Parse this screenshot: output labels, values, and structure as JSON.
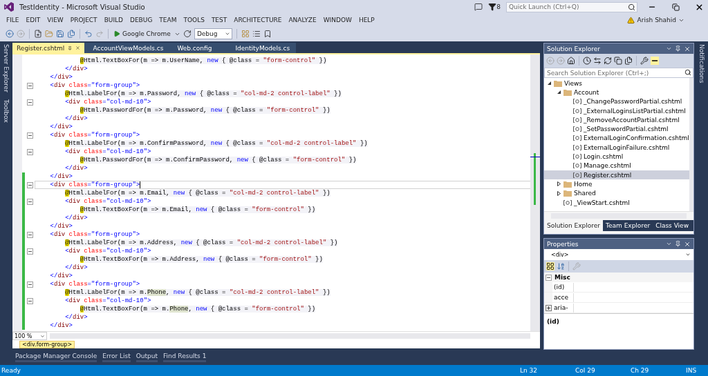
{
  "window": {
    "title": "TestIdentity - Microsoft Visual Studio",
    "notification_count": "8",
    "quick_launch": {
      "placeholder": "Quick Launch (Ctrl+Q)"
    }
  },
  "menu": [
    "FILE",
    "EDIT",
    "VIEW",
    "PROJECT",
    "BUILD",
    "DEBUG",
    "TEAM",
    "TOOLS",
    "TEST",
    "ARCHITECTURE",
    "ANALYZE",
    "WINDOW",
    "HELP"
  ],
  "user": {
    "name": "Arish Shahid"
  },
  "toolbar": {
    "run_target": "Google Chrome",
    "configuration": "Debug"
  },
  "side_tabs": [
    "Server Explorer",
    "Toolbox"
  ],
  "editor": {
    "tabs": [
      {
        "label": "Register.cshtml",
        "selected": true
      },
      {
        "label": "AccountViewModels.cs",
        "selected": false
      },
      {
        "label": "Web.config",
        "selected": false
      },
      {
        "label": "IdentityModels.cs",
        "selected": false
      }
    ],
    "lines": [
      {
        "fold": false,
        "changed": false,
        "current": false,
        "tokens": [
          {
            "kind": "at",
            "text": "@"
          },
          {
            "kind": "code",
            "text": "Html.TextBoxFor(m => m.UserName, "
          },
          {
            "kind": "kw",
            "text": "new"
          },
          {
            "kind": "code",
            "text": " { @class = "
          },
          {
            "kind": "str",
            "text": "\"form-control\""
          },
          {
            "kind": "code",
            "text": " })"
          }
        ]
      },
      {
        "fold": false,
        "changed": false,
        "current": false,
        "tokens": [
          {
            "kind": "close",
            "text": "</"
          },
          {
            "kind": "element",
            "text": "div"
          },
          {
            "kind": "punct",
            "text": ">"
          }
        ]
      },
      {
        "fold": false,
        "changed": false,
        "current": false,
        "tokens": [
          {
            "kind": "close",
            "text": "</"
          },
          {
            "kind": "element",
            "text": "div"
          },
          {
            "kind": "punct",
            "text": ">"
          }
        ]
      },
      {
        "fold": true,
        "changed": false,
        "current": false,
        "tokens": [
          {
            "kind": "open",
            "text": "<"
          },
          {
            "kind": "element",
            "text": "div"
          },
          {
            "kind": "attr",
            "text": " class"
          },
          {
            "kind": "punct",
            "text": "="
          },
          {
            "kind": "val",
            "text": "\"form-group\""
          },
          {
            "kind": "punct",
            "text": ">"
          }
        ]
      },
      {
        "fold": false,
        "changed": false,
        "current": false,
        "tokens": [
          {
            "kind": "at",
            "text": "@"
          },
          {
            "kind": "code",
            "text": "Html.LabelFor(m => m.Password, "
          },
          {
            "kind": "kw",
            "text": "new"
          },
          {
            "kind": "code",
            "text": " { @class = "
          },
          {
            "kind": "str",
            "text": "\"col-md-2 control-label\""
          },
          {
            "kind": "code",
            "text": " })"
          }
        ]
      },
      {
        "fold": true,
        "changed": false,
        "current": false,
        "tokens": [
          {
            "kind": "open",
            "text": "<"
          },
          {
            "kind": "element",
            "text": "div"
          },
          {
            "kind": "attr",
            "text": " class"
          },
          {
            "kind": "punct",
            "text": "="
          },
          {
            "kind": "val",
            "text": "\"col-md-10\""
          },
          {
            "kind": "punct",
            "text": ">"
          }
        ]
      },
      {
        "fold": false,
        "changed": false,
        "current": false,
        "tokens": [
          {
            "kind": "at",
            "text": "@"
          },
          {
            "kind": "code",
            "text": "Html.PasswordFor(m => m.Password, "
          },
          {
            "kind": "kw",
            "text": "new"
          },
          {
            "kind": "code",
            "text": " { @class = "
          },
          {
            "kind": "str",
            "text": "\"form-control\""
          },
          {
            "kind": "code",
            "text": " })"
          }
        ]
      },
      {
        "fold": false,
        "changed": false,
        "current": false,
        "tokens": [
          {
            "kind": "close",
            "text": "</"
          },
          {
            "kind": "element",
            "text": "div"
          },
          {
            "kind": "punct",
            "text": ">"
          }
        ]
      },
      {
        "fold": false,
        "changed": false,
        "current": false,
        "tokens": [
          {
            "kind": "close",
            "text": "</"
          },
          {
            "kind": "element",
            "text": "div"
          },
          {
            "kind": "punct",
            "text": ">"
          }
        ]
      },
      {
        "fold": true,
        "changed": false,
        "current": false,
        "tokens": [
          {
            "kind": "open",
            "text": "<"
          },
          {
            "kind": "element",
            "text": "div"
          },
          {
            "kind": "attr",
            "text": " class"
          },
          {
            "kind": "punct",
            "text": "="
          },
          {
            "kind": "val",
            "text": "\"form-group\""
          },
          {
            "kind": "punct",
            "text": ">"
          }
        ]
      },
      {
        "fold": false,
        "changed": false,
        "current": false,
        "tokens": [
          {
            "kind": "at",
            "text": "@"
          },
          {
            "kind": "code",
            "text": "Html.LabelFor(m => m.ConfirmPassword, "
          },
          {
            "kind": "kw",
            "text": "new"
          },
          {
            "kind": "code",
            "text": " { @class = "
          },
          {
            "kind": "str",
            "text": "\"col-md-2 control-label\""
          },
          {
            "kind": "code",
            "text": " })"
          }
        ]
      },
      {
        "fold": true,
        "changed": false,
        "current": false,
        "tokens": [
          {
            "kind": "open",
            "text": "<"
          },
          {
            "kind": "element",
            "text": "div"
          },
          {
            "kind": "attr",
            "text": " class"
          },
          {
            "kind": "punct",
            "text": "="
          },
          {
            "kind": "val",
            "text": "\"col-md-10\""
          },
          {
            "kind": "punct",
            "text": ">"
          }
        ]
      },
      {
        "fold": false,
        "changed": false,
        "current": false,
        "tokens": [
          {
            "kind": "at",
            "text": "@"
          },
          {
            "kind": "code",
            "text": "Html.PasswordFor(m => m.ConfirmPassword, "
          },
          {
            "kind": "kw",
            "text": "new"
          },
          {
            "kind": "code",
            "text": " { @class = "
          },
          {
            "kind": "str",
            "text": "\"form-control\""
          },
          {
            "kind": "code",
            "text": " })"
          }
        ]
      },
      {
        "fold": false,
        "changed": false,
        "current": false,
        "tokens": [
          {
            "kind": "close",
            "text": "</"
          },
          {
            "kind": "element",
            "text": "div"
          },
          {
            "kind": "punct",
            "text": ">"
          }
        ]
      },
      {
        "fold": false,
        "changed": true,
        "current": false,
        "tokens": [
          {
            "kind": "close",
            "text": "</"
          },
          {
            "kind": "element",
            "text": "div"
          },
          {
            "kind": "punct",
            "text": ">"
          }
        ]
      },
      {
        "fold": true,
        "changed": true,
        "current": true,
        "tokens": [
          {
            "kind": "open",
            "text": "<"
          },
          {
            "kind": "element",
            "text": "div"
          },
          {
            "kind": "attr",
            "text": " class"
          },
          {
            "kind": "punct",
            "text": "="
          },
          {
            "kind": "val",
            "text": "\"form-group\""
          },
          {
            "kind": "punct",
            "text": ">"
          }
        ]
      },
      {
        "fold": false,
        "changed": true,
        "current": false,
        "tokens": [
          {
            "kind": "at",
            "text": "@"
          },
          {
            "kind": "code",
            "text": "Html.LabelFor(m => m.Email, "
          },
          {
            "kind": "kw",
            "text": "new"
          },
          {
            "kind": "code",
            "text": " { @class = "
          },
          {
            "kind": "str",
            "text": "\"col-md-2 control-label\""
          },
          {
            "kind": "code",
            "text": " })"
          }
        ]
      },
      {
        "fold": true,
        "changed": true,
        "current": false,
        "tokens": [
          {
            "kind": "open",
            "text": "<"
          },
          {
            "kind": "element",
            "text": "div"
          },
          {
            "kind": "attr",
            "text": " class"
          },
          {
            "kind": "punct",
            "text": "="
          },
          {
            "kind": "val",
            "text": "\"col-md-10\""
          },
          {
            "kind": "punct",
            "text": ">"
          }
        ]
      },
      {
        "fold": false,
        "changed": true,
        "current": false,
        "tokens": [
          {
            "kind": "at",
            "text": "@"
          },
          {
            "kind": "code",
            "text": "Html.TextBoxFor(m => m.Email, "
          },
          {
            "kind": "kw",
            "text": "new"
          },
          {
            "kind": "code",
            "text": " { @class = "
          },
          {
            "kind": "str",
            "text": "\"form-control\""
          },
          {
            "kind": "code",
            "text": " })"
          }
        ]
      },
      {
        "fold": false,
        "changed": true,
        "current": false,
        "tokens": [
          {
            "kind": "close",
            "text": "</"
          },
          {
            "kind": "element",
            "text": "div"
          },
          {
            "kind": "punct",
            "text": ">"
          }
        ]
      },
      {
        "fold": false,
        "changed": true,
        "current": false,
        "tokens": [
          {
            "kind": "close",
            "text": "</"
          },
          {
            "kind": "element",
            "text": "div"
          },
          {
            "kind": "punct",
            "text": ">"
          }
        ]
      },
      {
        "fold": true,
        "changed": true,
        "current": false,
        "tokens": [
          {
            "kind": "open",
            "text": "<"
          },
          {
            "kind": "element",
            "text": "div"
          },
          {
            "kind": "attr",
            "text": " class"
          },
          {
            "kind": "punct",
            "text": "="
          },
          {
            "kind": "val",
            "text": "\"form-group\""
          },
          {
            "kind": "punct",
            "text": ">"
          }
        ]
      },
      {
        "fold": false,
        "changed": true,
        "current": false,
        "tokens": [
          {
            "kind": "at",
            "text": "@"
          },
          {
            "kind": "code",
            "text": "Html.LabelFor(m => m.Address, "
          },
          {
            "kind": "kw",
            "text": "new"
          },
          {
            "kind": "code",
            "text": " { @class = "
          },
          {
            "kind": "str",
            "text": "\"col-md-2 control-label\""
          },
          {
            "kind": "code",
            "text": " })"
          }
        ]
      },
      {
        "fold": true,
        "changed": true,
        "current": false,
        "tokens": [
          {
            "kind": "open",
            "text": "<"
          },
          {
            "kind": "element",
            "text": "div"
          },
          {
            "kind": "attr",
            "text": " class"
          },
          {
            "kind": "punct",
            "text": "="
          },
          {
            "kind": "val",
            "text": "\"col-md-10\""
          },
          {
            "kind": "punct",
            "text": ">"
          }
        ]
      },
      {
        "fold": false,
        "changed": true,
        "current": false,
        "tokens": [
          {
            "kind": "at",
            "text": "@"
          },
          {
            "kind": "code",
            "text": "Html.TextBoxFor(m => m.Address, "
          },
          {
            "kind": "kw",
            "text": "new"
          },
          {
            "kind": "code",
            "text": " { @class = "
          },
          {
            "kind": "str",
            "text": "\"form-control\""
          },
          {
            "kind": "code",
            "text": " })"
          }
        ]
      },
      {
        "fold": false,
        "changed": true,
        "current": false,
        "tokens": [
          {
            "kind": "close",
            "text": "</"
          },
          {
            "kind": "element",
            "text": "div"
          },
          {
            "kind": "punct",
            "text": ">"
          }
        ]
      },
      {
        "fold": false,
        "changed": true,
        "current": false,
        "tokens": [
          {
            "kind": "close",
            "text": "</"
          },
          {
            "kind": "element",
            "text": "div"
          },
          {
            "kind": "punct",
            "text": ">"
          }
        ]
      },
      {
        "fold": true,
        "changed": true,
        "current": false,
        "tokens": [
          {
            "kind": "open",
            "text": "<"
          },
          {
            "kind": "element",
            "text": "div"
          },
          {
            "kind": "attr",
            "text": " class"
          },
          {
            "kind": "punct",
            "text": "="
          },
          {
            "kind": "val",
            "text": "\"form-group\""
          },
          {
            "kind": "punct",
            "text": ">"
          }
        ]
      },
      {
        "fold": false,
        "changed": true,
        "current": false,
        "tokens": [
          {
            "kind": "at",
            "text": "@"
          },
          {
            "kind": "code",
            "text": "Html.LabelFor(m => m."
          },
          {
            "kind": "ref",
            "text": "Phone"
          },
          {
            "kind": "code",
            "text": ", "
          },
          {
            "kind": "kw",
            "text": "new"
          },
          {
            "kind": "code",
            "text": " { @class = "
          },
          {
            "kind": "str",
            "text": "\"col-md-2 control-label\""
          },
          {
            "kind": "code",
            "text": " })"
          }
        ]
      },
      {
        "fold": true,
        "changed": true,
        "current": false,
        "tokens": [
          {
            "kind": "open",
            "text": "<"
          },
          {
            "kind": "element",
            "text": "div"
          },
          {
            "kind": "attr",
            "text": " class"
          },
          {
            "kind": "punct",
            "text": "="
          },
          {
            "kind": "val",
            "text": "\"col-md-10\""
          },
          {
            "kind": "punct",
            "text": ">"
          }
        ]
      },
      {
        "fold": false,
        "changed": true,
        "current": false,
        "tokens": [
          {
            "kind": "at",
            "text": "@"
          },
          {
            "kind": "code",
            "text": "Html.TextBoxFor(m => m."
          },
          {
            "kind": "ref",
            "text": "Phone"
          },
          {
            "kind": "code",
            "text": ", "
          },
          {
            "kind": "kw",
            "text": "new"
          },
          {
            "kind": "code",
            "text": " { @class = "
          },
          {
            "kind": "str",
            "text": "\"form-control\""
          },
          {
            "kind": "code",
            "text": " })"
          }
        ]
      },
      {
        "fold": false,
        "changed": true,
        "current": false,
        "tokens": [
          {
            "kind": "close",
            "text": "</"
          },
          {
            "kind": "element",
            "text": "div"
          },
          {
            "kind": "punct",
            "text": ">"
          }
        ]
      },
      {
        "fold": false,
        "changed": true,
        "current": false,
        "tokens": [
          {
            "kind": "close",
            "text": "</"
          },
          {
            "kind": "element",
            "text": "div"
          },
          {
            "kind": "punct",
            "text": ">"
          }
        ]
      }
    ],
    "zoom": "100 %",
    "breadcrumb": "<div.form-group>"
  },
  "solution_explorer": {
    "title": "Solution Explorer",
    "search": {
      "placeholder": "Search Solution Explorer (Ctrl+;)"
    },
    "tree": [
      {
        "label": "Views",
        "kind": "folder",
        "expanded": true,
        "selected": false,
        "children": [
          {
            "label": "Account",
            "kind": "folder",
            "expanded": true,
            "selected": false,
            "children": [
              {
                "label": "_ChangePasswordPartial.cshtml",
                "kind": "file",
                "selected": false
              },
              {
                "label": "_ExternalLoginsListPartial.cshtml",
                "kind": "file",
                "selected": false
              },
              {
                "label": "_RemoveAccountPartial.cshtml",
                "kind": "file",
                "selected": false
              },
              {
                "label": "_SetPasswordPartial.cshtml",
                "kind": "file",
                "selected": false
              },
              {
                "label": "ExternalLoginConfirmation.cshtml",
                "kind": "file",
                "selected": false
              },
              {
                "label": "ExternalLoginFailure.cshtml",
                "kind": "file",
                "selected": false
              },
              {
                "label": "Login.cshtml",
                "kind": "file",
                "selected": false
              },
              {
                "label": "Manage.cshtml",
                "kind": "file",
                "selected": false
              },
              {
                "label": "Register.cshtml",
                "kind": "file",
                "selected": true
              }
            ]
          },
          {
            "label": "Home",
            "kind": "folder",
            "expanded": false,
            "selected": false
          },
          {
            "label": "Shared",
            "kind": "folder",
            "expanded": false,
            "selected": false
          },
          {
            "label": "_ViewStart.cshtml",
            "kind": "file",
            "selected": false
          }
        ]
      }
    ],
    "tabs": [
      {
        "label": "Solution Explorer",
        "selected": true
      },
      {
        "label": "Team Explorer",
        "selected": false
      },
      {
        "label": "Class View",
        "selected": false
      }
    ]
  },
  "properties": {
    "title": "Properties",
    "object": "<div>",
    "category": "Misc",
    "rows": [
      {
        "name": "(id)",
        "expandable": false
      },
      {
        "name": "acce",
        "expandable": false
      },
      {
        "name": "aria-",
        "expandable": true
      }
    ],
    "description": "(id)"
  },
  "right_tabs": [
    "Notifications"
  ],
  "bottom_tabs": [
    "Package Manager Console",
    "Error List",
    "Output",
    "Find Results 1"
  ],
  "status": {
    "message": "Ready",
    "line": "Ln 32",
    "column": "Col 29",
    "char": "Ch 29",
    "mode": "INS"
  }
}
